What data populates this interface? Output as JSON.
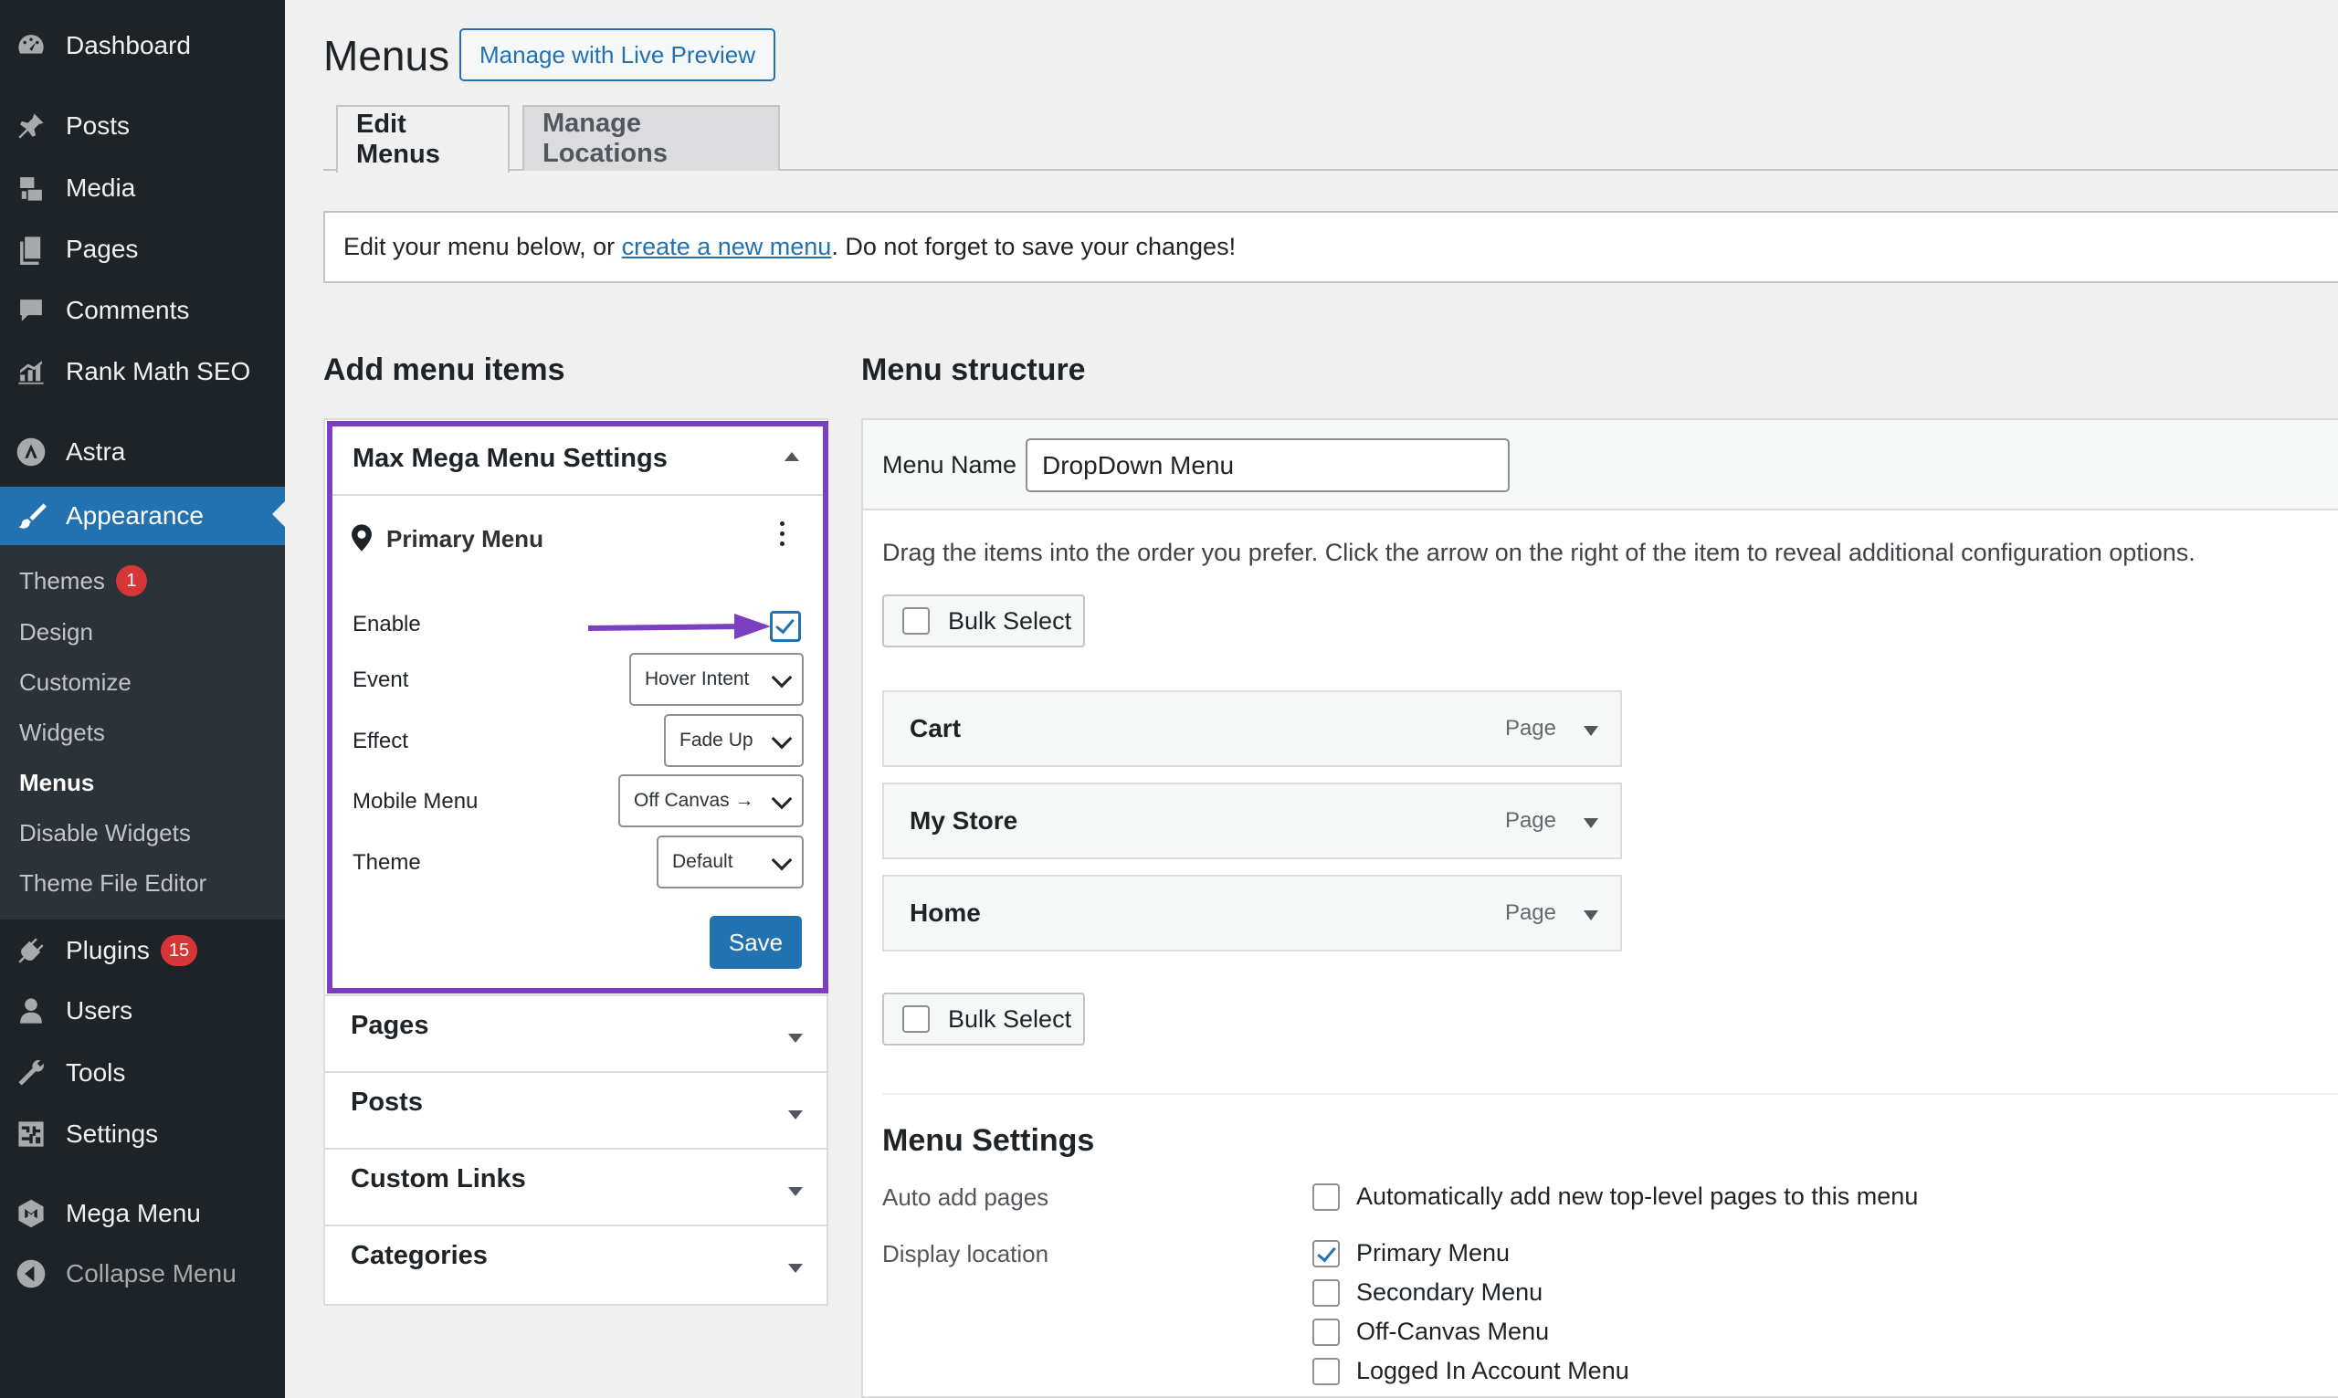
{
  "sidebar": {
    "items": [
      {
        "label": "Dashboard",
        "icon": "dashboard-icon"
      },
      {
        "label": "Posts",
        "icon": "pin-icon"
      },
      {
        "label": "Media",
        "icon": "media-icon"
      },
      {
        "label": "Pages",
        "icon": "pages-icon"
      },
      {
        "label": "Comments",
        "icon": "comments-icon"
      },
      {
        "label": "Rank Math SEO",
        "icon": "chart-icon"
      },
      {
        "label": "Astra",
        "icon": "astra-icon"
      },
      {
        "label": "Appearance",
        "icon": "brush-icon"
      },
      {
        "label": "Plugins",
        "icon": "plugin-icon",
        "badge": "15"
      },
      {
        "label": "Users",
        "icon": "user-icon"
      },
      {
        "label": "Tools",
        "icon": "wrench-icon"
      },
      {
        "label": "Settings",
        "icon": "settings-icon"
      },
      {
        "label": "Mega Menu",
        "icon": "mega-menu-icon"
      },
      {
        "label": "Collapse Menu",
        "icon": "collapse-icon"
      }
    ],
    "submenu": [
      {
        "label": "Themes",
        "badge": "1"
      },
      {
        "label": "Design"
      },
      {
        "label": "Customize"
      },
      {
        "label": "Widgets"
      },
      {
        "label": "Menus"
      },
      {
        "label": "Disable Widgets"
      },
      {
        "label": "Theme File Editor"
      }
    ]
  },
  "header": {
    "title": "Menus",
    "live_preview_label": "Manage with Live Preview",
    "tabs": [
      {
        "label": "Edit Menus"
      },
      {
        "label": "Manage Locations"
      }
    ]
  },
  "notice": {
    "before": "Edit your menu below, or ",
    "link": "create a new menu",
    "after": ". Do not forget to save your changes!"
  },
  "add_items": {
    "heading": "Add menu items",
    "mmm": {
      "title": "Max Mega Menu Settings",
      "location": "Primary Menu",
      "enable_label": "Enable",
      "enable_checked": true,
      "event_label": "Event",
      "event_value": "Hover Intent",
      "effect_label": "Effect",
      "effect_value": "Fade Up",
      "mobile_label": "Mobile Menu",
      "mobile_value": "Off Canvas →",
      "theme_label": "Theme",
      "theme_value": "Default",
      "save_label": "Save",
      "highlight_color": "#7b3fbf"
    },
    "panels": [
      {
        "label": "Pages"
      },
      {
        "label": "Posts"
      },
      {
        "label": "Custom Links"
      },
      {
        "label": "Categories"
      }
    ]
  },
  "structure": {
    "heading": "Menu structure",
    "menu_name_label": "Menu Name",
    "menu_name_value": "DropDown Menu",
    "instructions": "Drag the items into the order you prefer. Click the arrow on the right of the item to reveal additional configuration options.",
    "bulk_select_label": "Bulk Select",
    "items": [
      {
        "title": "Cart",
        "type": "Page"
      },
      {
        "title": "My Store",
        "type": "Page"
      },
      {
        "title": "Home",
        "type": "Page"
      }
    ],
    "settings": {
      "heading": "Menu Settings",
      "auto_add_label": "Auto add pages",
      "auto_add_option": "Automatically add new top-level pages to this menu",
      "display_location_label": "Display location",
      "locations": [
        {
          "label": "Primary Menu",
          "checked": true
        },
        {
          "label": "Secondary Menu",
          "checked": false
        },
        {
          "label": "Off-Canvas Menu",
          "checked": false
        },
        {
          "label": "Logged In Account Menu",
          "checked": false
        }
      ]
    }
  },
  "colors": {
    "sidebar_bg": "#1d2327",
    "accent": "#2271b1",
    "badge": "#d63638"
  }
}
